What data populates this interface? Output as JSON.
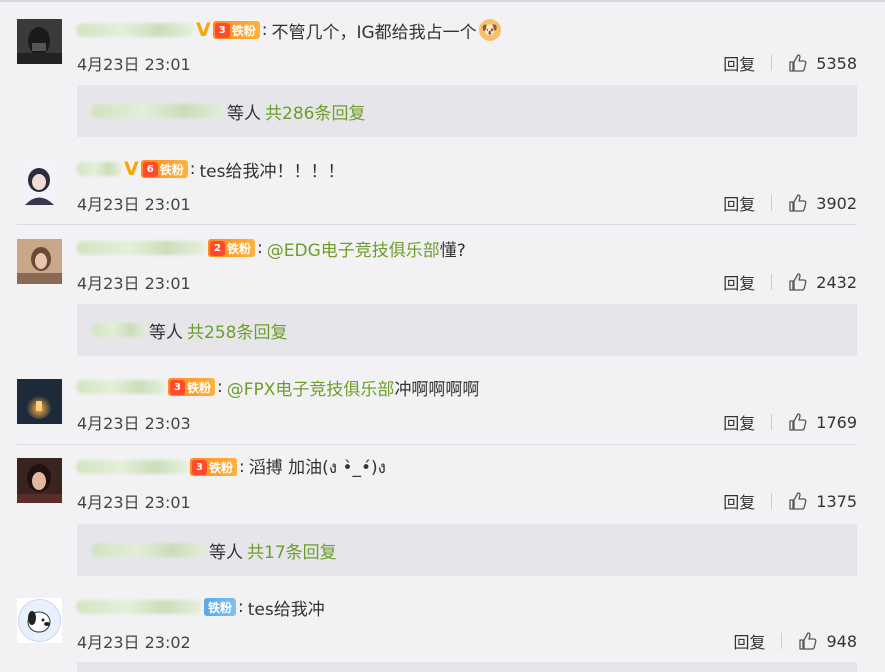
{
  "comments": [
    {
      "badge_level": "3",
      "badge_text": "铁粉",
      "text": "不管几个，IG都给我占一个",
      "time": "4月23日 23:01",
      "reply_label": "回复",
      "likes": "5358",
      "sub": {
        "suffix": "等人",
        "total": "共286条回复"
      }
    },
    {
      "badge_level": "6",
      "badge_text": "铁粉",
      "text": "tes给我冲！！！！",
      "time": "4月23日 23:01",
      "reply_label": "回复",
      "likes": "3902"
    },
    {
      "badge_level": "2",
      "badge_text": "铁粉",
      "mention": "@EDG电子竞技俱乐部",
      "text": " 懂?",
      "time": "4月23日 23:01",
      "reply_label": "回复",
      "likes": "2432",
      "sub": {
        "suffix": "等人",
        "total": "共258条回复"
      }
    },
    {
      "badge_level": "3",
      "badge_text": "铁粉",
      "mention": "@FPX电子竞技俱乐部",
      "text": " 冲啊啊啊啊",
      "time": "4月23日 23:03",
      "reply_label": "回复",
      "likes": "1769"
    },
    {
      "badge_level": "3",
      "badge_text": "铁粉",
      "text": "滔搏 加油(ง •̀_•́)ง",
      "time": "4月23日 23:01",
      "reply_label": "回复",
      "likes": "1375",
      "sub": {
        "suffix": "等人",
        "total": "共17条回复"
      }
    },
    {
      "badge_text": "铁粉",
      "text": "tes给我冲",
      "time": "4月23日 23:02",
      "reply_label": "回复",
      "likes": "948"
    }
  ],
  "colors": {
    "mention": "#6d9e2a",
    "fan_badge": "#ff9a2b",
    "background": "#f2f2f5"
  }
}
